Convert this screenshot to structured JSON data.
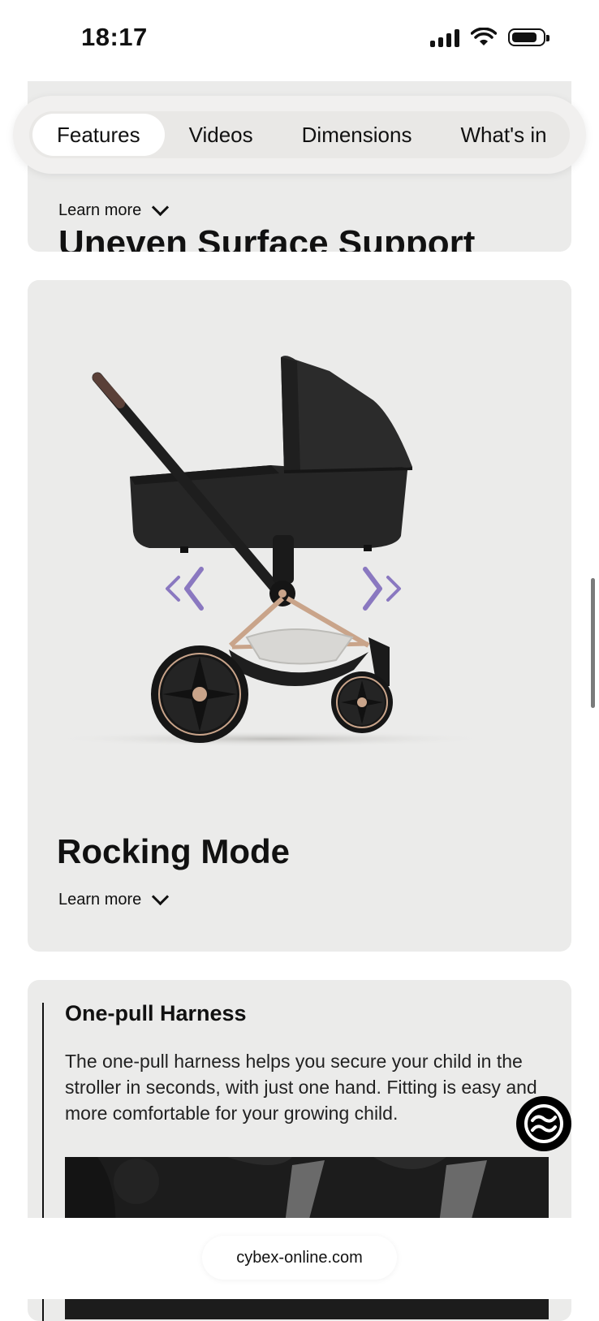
{
  "status_bar": {
    "time": "18:17"
  },
  "nav": {
    "tabs": [
      {
        "label": "Features",
        "active": true
      },
      {
        "label": "Videos",
        "active": false
      },
      {
        "label": "Dimensions",
        "active": false
      },
      {
        "label": "What's in",
        "active": false
      }
    ]
  },
  "cards": [
    {
      "title": "Uneven Surface Support",
      "learn_more": "Learn more"
    },
    {
      "title": "Rocking Mode",
      "learn_more": "Learn more"
    }
  ],
  "harness": {
    "title": "One-pull Harness",
    "body": "The one-pull harness helps you secure your child in the stroller in seconds, with just one hand. Fitting is easy and more comfortable for your growing child."
  },
  "browser": {
    "url": "cybex-online.com"
  },
  "colors": {
    "card_bg": "#ebebea",
    "arrow_purple": "#8a78c0",
    "frame_rose_gold": "#c9a48a"
  },
  "icons": [
    "cellular-signal-icon",
    "wifi-icon",
    "battery-icon",
    "chevron-down-icon",
    "cybex-logo-icon"
  ]
}
